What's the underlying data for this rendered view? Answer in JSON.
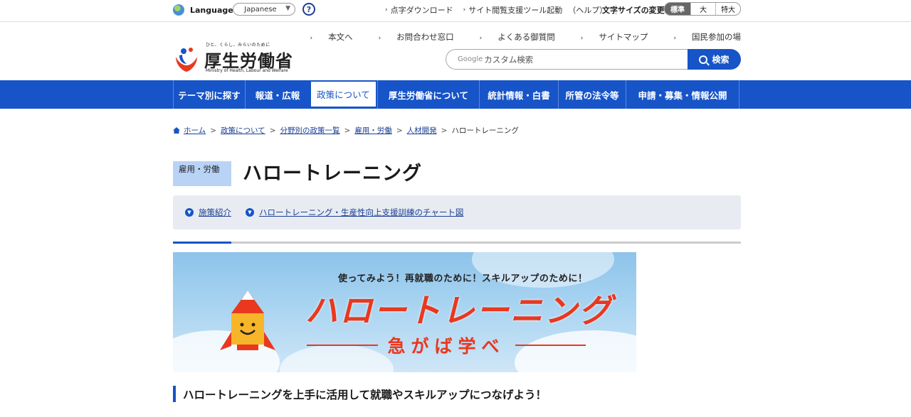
{
  "utility": {
    "language_label": "Language",
    "language_value": "Japanese",
    "help_glyph": "?",
    "links": [
      "点字ダウンロード",
      "サイト閲覧支援ツール起動",
      "（ヘルプ）"
    ],
    "font_size_label": "文字サイズの変更",
    "font_sizes": [
      "標準",
      "大",
      "特大"
    ]
  },
  "header": {
    "logo_tagline": "ひと、くらし、みらいのために",
    "logo_name": "厚生労働省",
    "logo_english": "Ministry of Health, Labour and Welfare",
    "links": [
      "本文へ",
      "お問合わせ窓口",
      "よくある御質問",
      "サイトマップ",
      "国民参加の場"
    ],
    "search_google": "Google",
    "search_placeholder": "カスタム検索",
    "search_button": "検索"
  },
  "nav": {
    "items": [
      "テーマ別に探す",
      "報道・広報",
      "政策について",
      "厚生労働省について",
      "統計情報・白書",
      "所管の法令等",
      "申請・募集・情報公開"
    ],
    "active_index": 2
  },
  "breadcrumb": [
    "ホーム",
    "政策について",
    "分野別の政策一覧",
    "雇用・労働",
    "人材開発",
    "ハロートレーニング"
  ],
  "category_badge": "雇用・労働",
  "page_title": "ハロートレーニング",
  "anchors": [
    "施策紹介",
    "ハロートレーニング・生産性向上支援訓練のチャート図"
  ],
  "banner": {
    "subtitle": "使ってみよう！再就職のために！スキルアップのために！",
    "title": "ハロートレーニング",
    "tagline": "急がば学べ"
  },
  "lead_heading": "ハロートレーニングを上手に活用して就職やスキルアップにつなげよう！",
  "colors": {
    "primary": "#1654c8",
    "badge": "#b9d3f7",
    "banner_red": "#e9381e"
  }
}
